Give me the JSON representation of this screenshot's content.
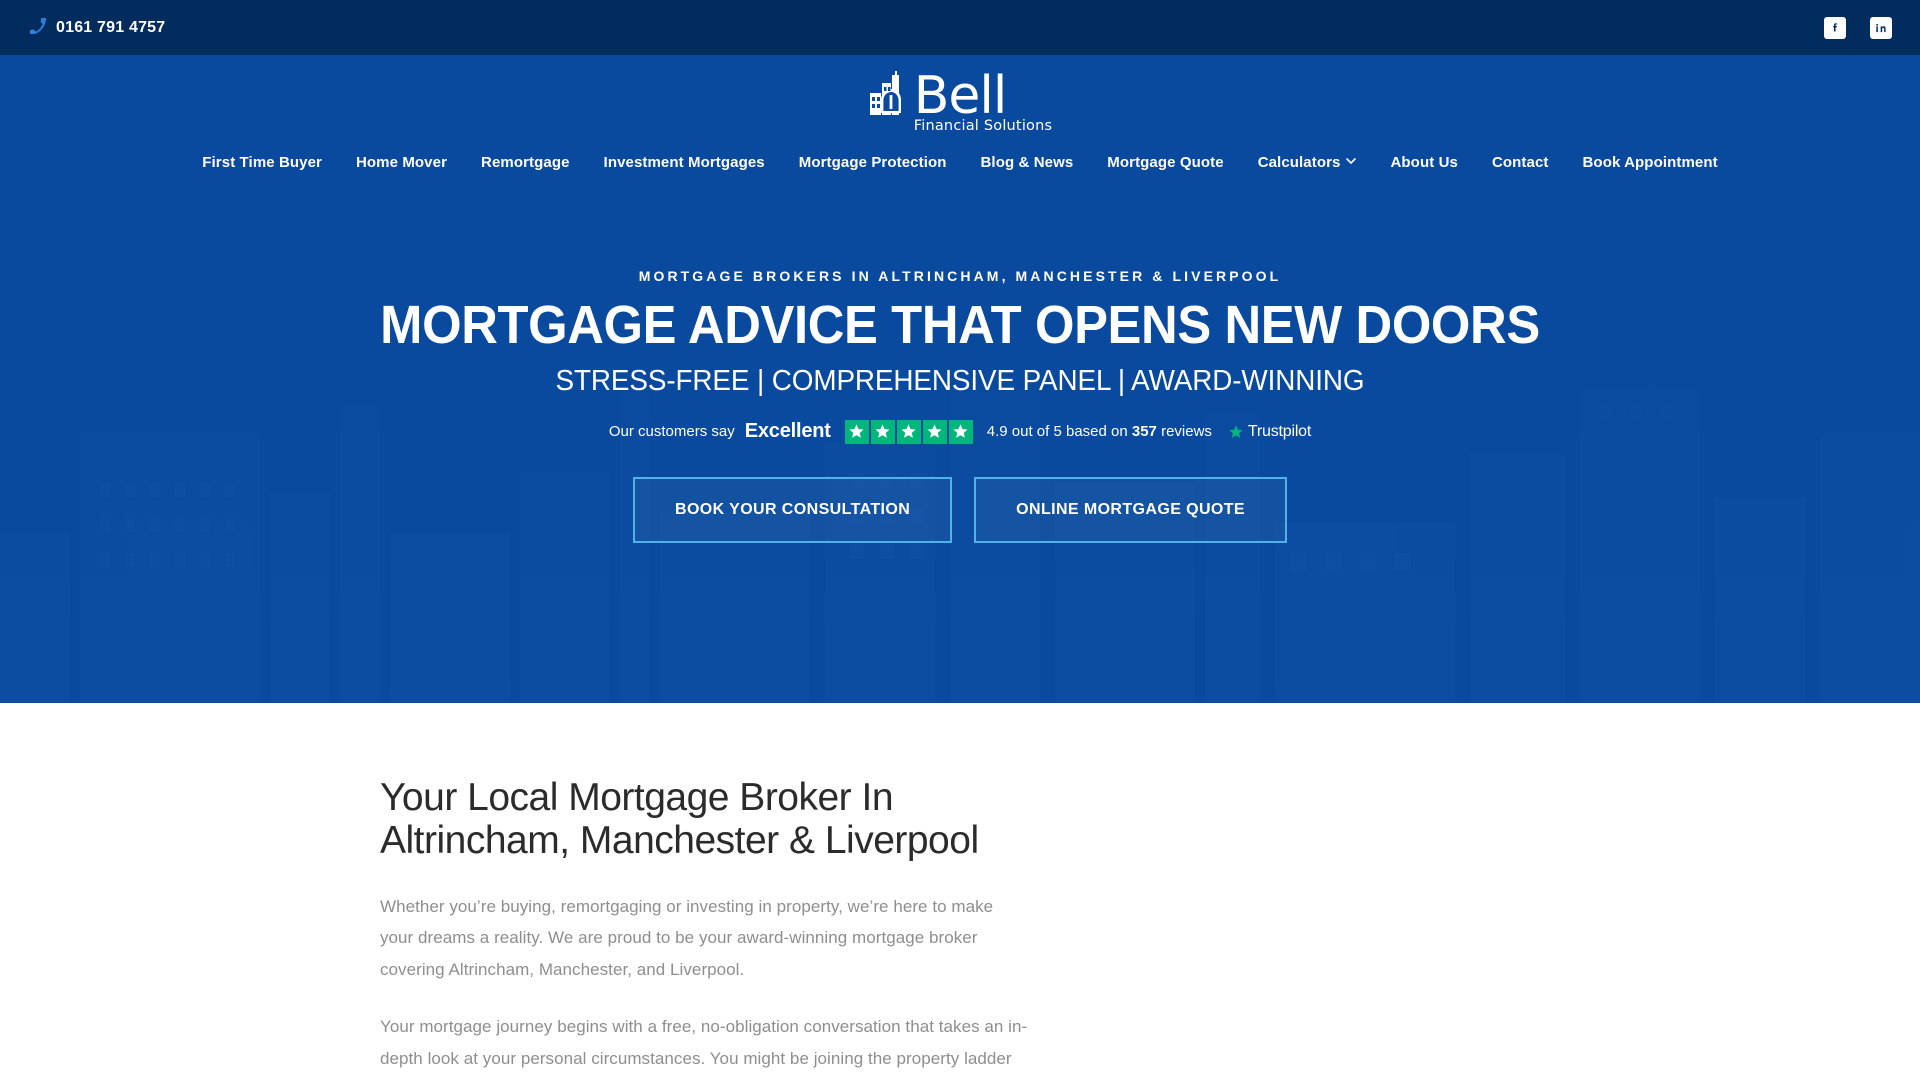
{
  "topbar": {
    "phone": "0161 791 4757",
    "phone_icon": "phone-icon",
    "socials": [
      {
        "name": "facebook-icon",
        "label": "Facebook"
      },
      {
        "name": "linkedin-icon",
        "label": "LinkedIn"
      }
    ]
  },
  "brand": {
    "name": "Bell",
    "tagline": "Financial Solutions",
    "logo_icon": "bell-building-logo-icon"
  },
  "nav": {
    "items": [
      {
        "label": "First Time Buyer",
        "has_dropdown": false
      },
      {
        "label": "Home Mover",
        "has_dropdown": false
      },
      {
        "label": "Remortgage",
        "has_dropdown": false
      },
      {
        "label": "Investment Mortgages",
        "has_dropdown": false
      },
      {
        "label": "Mortgage Protection",
        "has_dropdown": false
      },
      {
        "label": "Blog & News",
        "has_dropdown": false
      },
      {
        "label": "Mortgage Quote",
        "has_dropdown": false
      },
      {
        "label": "Calculators",
        "has_dropdown": true
      },
      {
        "label": "About Us",
        "has_dropdown": false
      },
      {
        "label": "Contact",
        "has_dropdown": false
      },
      {
        "label": "Book Appointment",
        "has_dropdown": false
      }
    ],
    "caret": "⌄"
  },
  "hero": {
    "eyebrow": "MORTGAGE BROKERS IN ALTRINCHAM, MANCHESTER & LIVERPOOL",
    "title": "MORTGAGE ADVICE THAT OPENS NEW DOORS",
    "subtitle": "STRESS-FREE | COMPREHENSIVE PANEL  |  AWARD-WINNING",
    "buttons": [
      {
        "label": "BOOK YOUR CONSULTATION"
      },
      {
        "label": "ONLINE MORTGAGE QUOTE"
      }
    ],
    "background_color": "#0a4a9e",
    "button_border_color": "#4fb3e8"
  },
  "trustpilot": {
    "prefix": "Our customers say",
    "rating_word": "Excellent",
    "stars_filled": 5,
    "stars_total": 5,
    "score_prefix": "4.9 out of 5 based on ",
    "review_count": "357",
    "score_suffix": " reviews",
    "brand": "Trustpilot",
    "star_color": "#00b67a"
  },
  "section": {
    "title": "Your Local Mortgage Broker In Altrincham, Manchester & Liverpool",
    "paragraphs": [
      "Whether you’re buying, remortgaging or investing in property, we’re here to make your dreams a reality. We are proud to be your award-winning mortgage broker covering Altrincham, Manchester, and Liverpool.",
      "Your mortgage journey begins with a free, no-obligation conversation that takes an in-depth look at your personal circumstances. You might be joining the property ladder"
    ]
  }
}
